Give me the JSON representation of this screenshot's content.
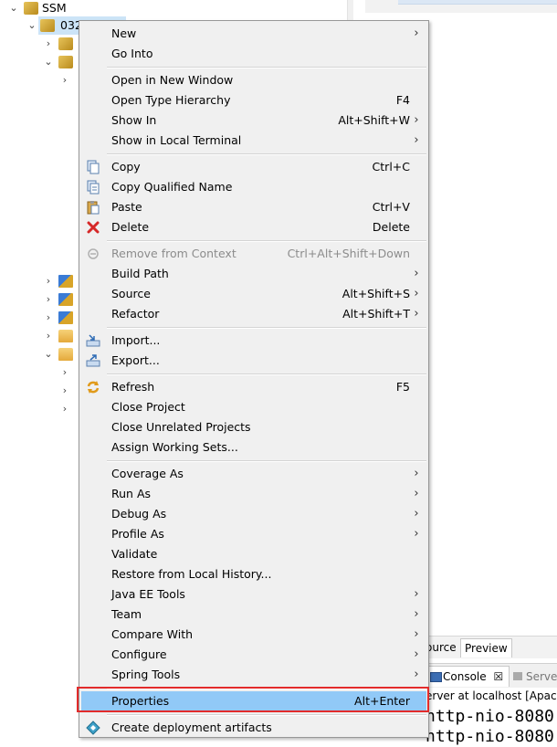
{
  "tree": {
    "root_label": "SSM",
    "project_label": "032"
  },
  "editor": {
    "tabs": [
      {
        "label": "ource"
      },
      {
        "label": "Preview"
      }
    ],
    "console": {
      "console_label": "Console",
      "close_glyph": "☒",
      "servers_label": "Server",
      "description": "erver at localhost [Apach",
      "lines": [
        "http-nio-8080",
        "http-nio-8080"
      ]
    }
  },
  "menu": {
    "arrow": "›",
    "items": [
      {
        "id": "new",
        "label": "New",
        "shortcut": "",
        "submenu": true
      },
      {
        "id": "go-into",
        "label": "Go Into",
        "shortcut": "",
        "submenu": false
      },
      {
        "id": "open-new-window",
        "label": "Open in New Window",
        "shortcut": "",
        "submenu": false
      },
      {
        "id": "open-type-hierarchy",
        "label": "Open Type Hierarchy",
        "shortcut": "F4",
        "submenu": false
      },
      {
        "id": "show-in",
        "label": "Show In",
        "shortcut": "Alt+Shift+W",
        "submenu": true
      },
      {
        "id": "show-local-terminal",
        "label": "Show in Local Terminal",
        "shortcut": "",
        "submenu": true
      },
      {
        "id": "copy",
        "label": "Copy",
        "shortcut": "Ctrl+C",
        "submenu": false,
        "icon": "copy-icon"
      },
      {
        "id": "copy-qualified-name",
        "label": "Copy Qualified Name",
        "shortcut": "",
        "submenu": false,
        "icon": "copy-qualified-icon"
      },
      {
        "id": "paste",
        "label": "Paste",
        "shortcut": "Ctrl+V",
        "submenu": false,
        "icon": "paste-icon"
      },
      {
        "id": "delete",
        "label": "Delete",
        "shortcut": "Delete",
        "submenu": false,
        "icon": "delete-icon"
      },
      {
        "id": "remove-from-context",
        "label": "Remove from Context",
        "shortcut": "Ctrl+Alt+Shift+Down",
        "submenu": false,
        "disabled": true,
        "icon": "remove-context-icon"
      },
      {
        "id": "build-path",
        "label": "Build Path",
        "shortcut": "",
        "submenu": true
      },
      {
        "id": "source",
        "label": "Source",
        "shortcut": "Alt+Shift+S",
        "submenu": true
      },
      {
        "id": "refactor",
        "label": "Refactor",
        "shortcut": "Alt+Shift+T",
        "submenu": true
      },
      {
        "id": "import",
        "label": "Import...",
        "shortcut": "",
        "submenu": false,
        "icon": "import-icon"
      },
      {
        "id": "export",
        "label": "Export...",
        "shortcut": "",
        "submenu": false,
        "icon": "export-icon"
      },
      {
        "id": "refresh",
        "label": "Refresh",
        "shortcut": "F5",
        "submenu": false,
        "icon": "refresh-icon"
      },
      {
        "id": "close-project",
        "label": "Close Project",
        "shortcut": "",
        "submenu": false
      },
      {
        "id": "close-unrelated",
        "label": "Close Unrelated Projects",
        "shortcut": "",
        "submenu": false
      },
      {
        "id": "assign-working-sets",
        "label": "Assign Working Sets...",
        "shortcut": "",
        "submenu": false
      },
      {
        "id": "coverage-as",
        "label": "Coverage As",
        "shortcut": "",
        "submenu": true
      },
      {
        "id": "run-as",
        "label": "Run As",
        "shortcut": "",
        "submenu": true
      },
      {
        "id": "debug-as",
        "label": "Debug As",
        "shortcut": "",
        "submenu": true
      },
      {
        "id": "profile-as",
        "label": "Profile As",
        "shortcut": "",
        "submenu": true
      },
      {
        "id": "validate",
        "label": "Validate",
        "shortcut": "",
        "submenu": false
      },
      {
        "id": "restore-local-history",
        "label": "Restore from Local History...",
        "shortcut": "",
        "submenu": false
      },
      {
        "id": "java-ee-tools",
        "label": "Java EE Tools",
        "shortcut": "",
        "submenu": true
      },
      {
        "id": "team",
        "label": "Team",
        "shortcut": "",
        "submenu": true
      },
      {
        "id": "compare-with",
        "label": "Compare With",
        "shortcut": "",
        "submenu": true
      },
      {
        "id": "configure",
        "label": "Configure",
        "shortcut": "",
        "submenu": true
      },
      {
        "id": "spring-tools",
        "label": "Spring Tools",
        "shortcut": "",
        "submenu": true
      },
      {
        "id": "properties",
        "label": "Properties",
        "shortcut": "Alt+Enter",
        "submenu": false,
        "highlighted": true
      },
      {
        "id": "create-deployment-artifacts",
        "label": "Create deployment artifacts",
        "shortcut": "",
        "submenu": false,
        "icon": "deployment-icon"
      }
    ]
  },
  "colors": {
    "menu_bg": "#f0f0f0",
    "highlight": "#91c9f7",
    "annotation_border": "#e22b2b",
    "selection": "#cce4f7"
  }
}
